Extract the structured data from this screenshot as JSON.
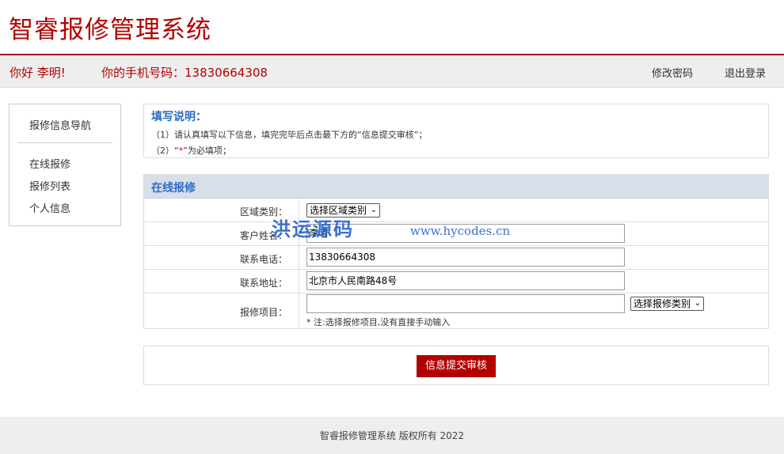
{
  "header": {
    "logo": "智睿报修管理系统"
  },
  "userbar": {
    "greeting": "你好 李明!",
    "phone": "你的手机号码：13830664308",
    "change_password": "修改密码",
    "logout": "退出登录"
  },
  "sidebar": {
    "title": "报修信息导航",
    "items": [
      {
        "label": "在线报修"
      },
      {
        "label": "报修列表"
      },
      {
        "label": "个人信息"
      }
    ]
  },
  "notice": {
    "title": "填写说明：",
    "line1": "（1）请认真填写以下信息，填完完毕后点击最下方的“信息提交审核”；",
    "line2_pre": "（2）“",
    "line2_star": "*",
    "line2_post": "”为必填项；"
  },
  "form": {
    "title": "在线报修",
    "area_label": "区域类别：",
    "area_select": "选择区域类别",
    "name_label": "客户姓名：",
    "name_value": "李明",
    "phone_label": "联系电话：",
    "phone_value": "13830664308",
    "address_label": "联系地址：",
    "address_value": "北京市人民南路48号",
    "item_label": "报修项目：",
    "item_value": "",
    "item_select": "选择报修类别",
    "item_note": "* 注:选择报修项目,没有直接手动输入"
  },
  "watermark": {
    "text": "洪运源码",
    "url": "www.hycodes.cn"
  },
  "submit": {
    "label": "信息提交审核"
  },
  "footer": {
    "text": "智睿报修管理系统  版权所有    2022"
  },
  "colors": {
    "brand": "#b30000",
    "accent": "#2b6cc4"
  }
}
